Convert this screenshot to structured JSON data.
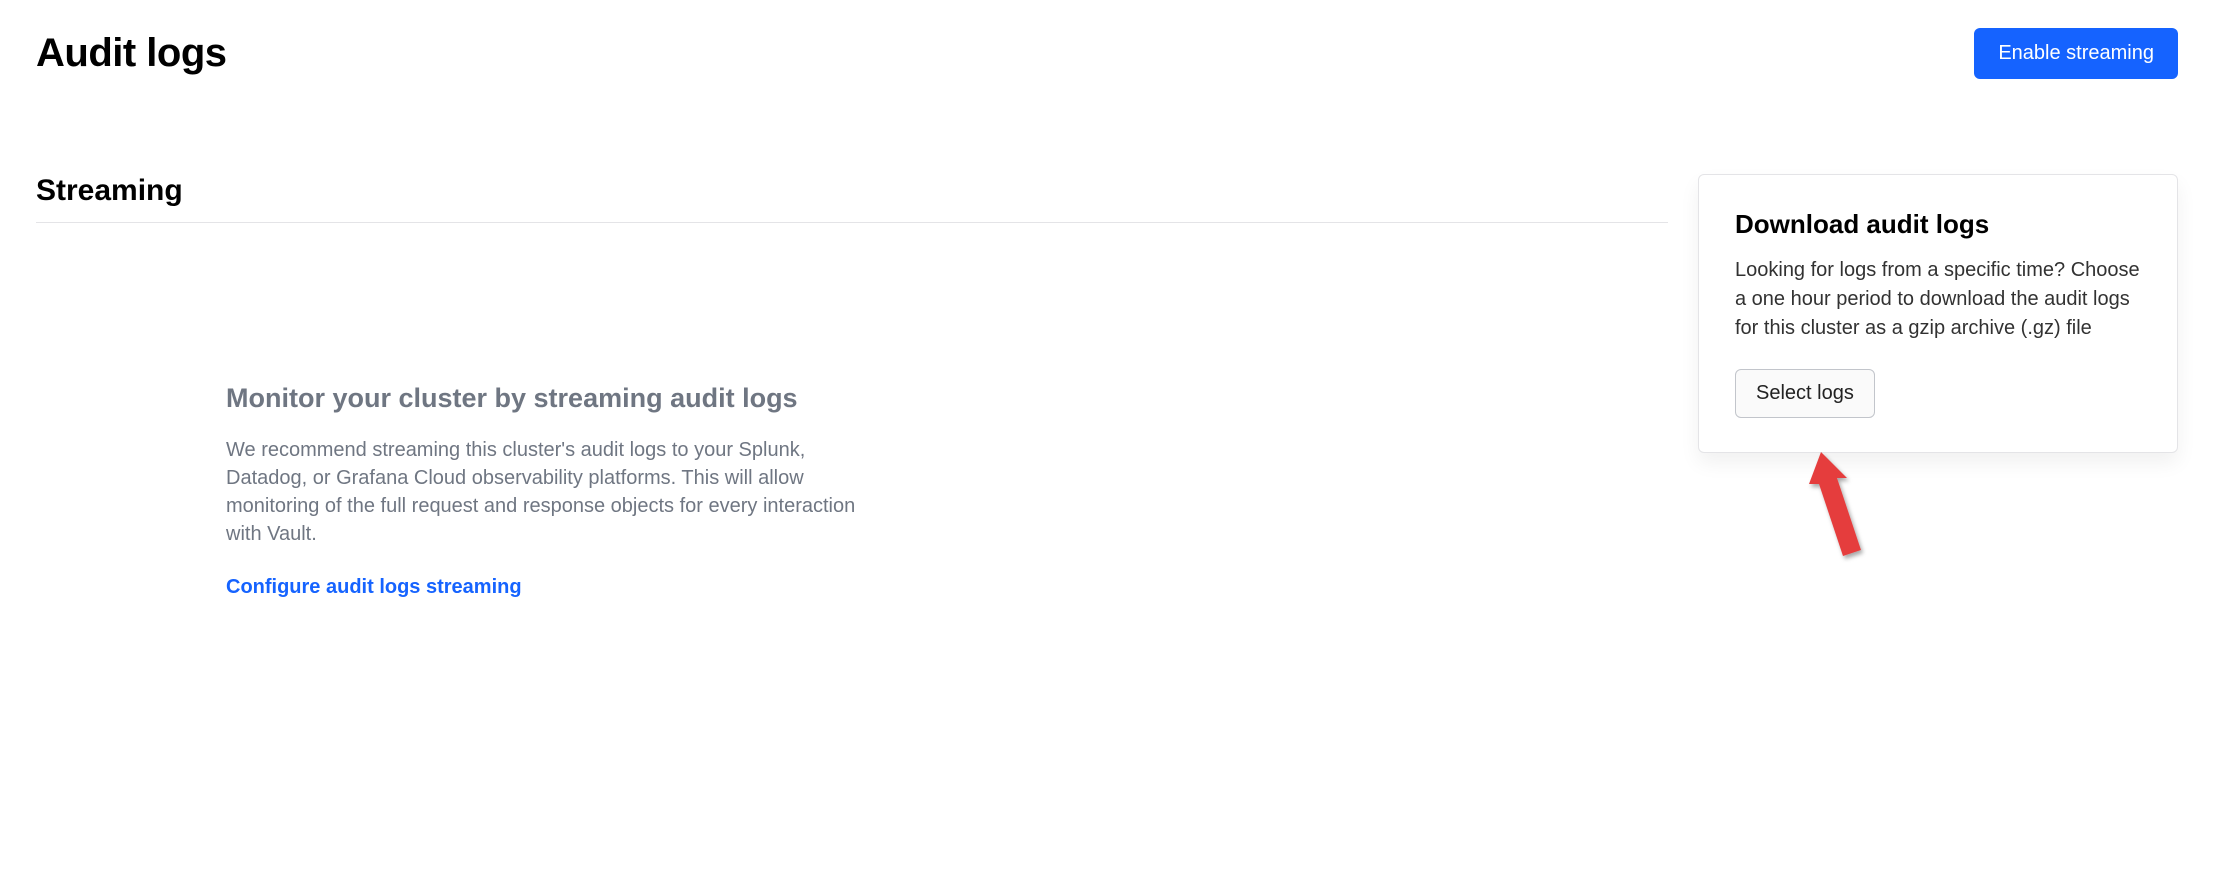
{
  "header": {
    "title": "Audit logs",
    "enable_button": "Enable streaming"
  },
  "streaming": {
    "section_title": "Streaming",
    "empty_title": "Monitor your cluster by streaming audit logs",
    "empty_body": "We recommend streaming this cluster's audit logs to your Splunk, Datadog, or Grafana Cloud observability platforms. This will allow monitoring of the full request and response objects for every interaction with Vault.",
    "configure_link": "Configure audit logs streaming"
  },
  "download_card": {
    "title": "Download audit logs",
    "body": "Looking for logs from a specific time? Choose a one hour period to download the audit logs for this cluster as a gzip archive (.gz) file",
    "select_button": "Select logs"
  }
}
